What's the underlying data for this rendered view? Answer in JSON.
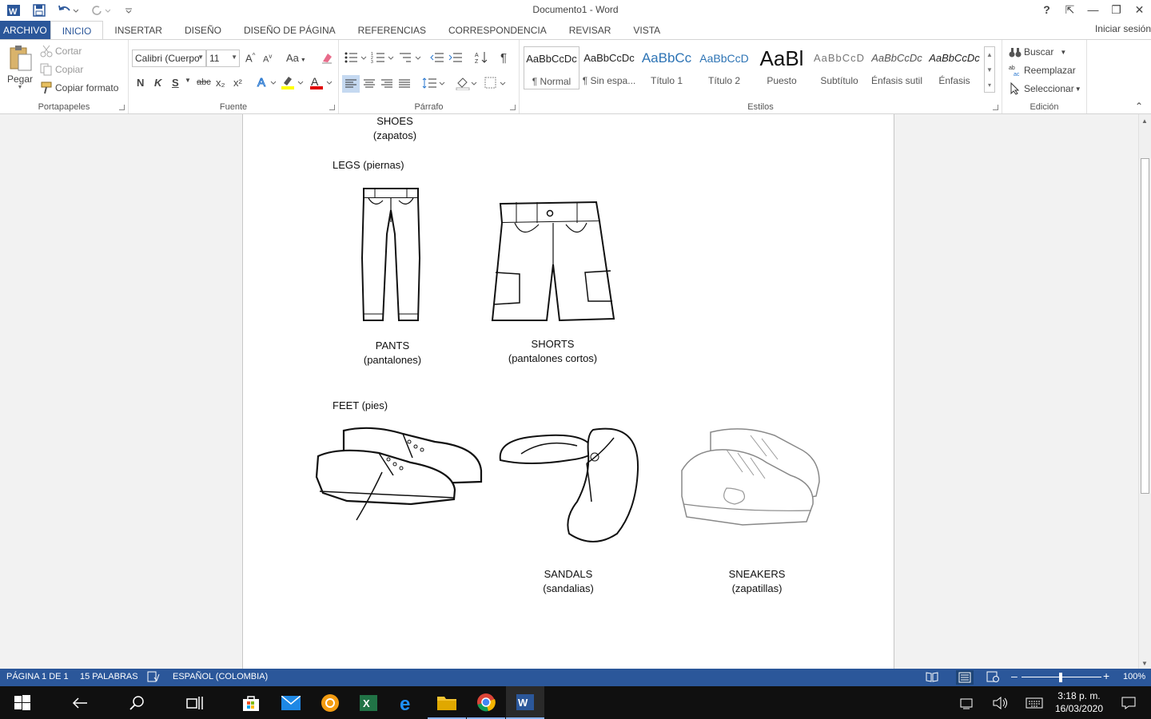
{
  "window": {
    "title": "Documento1 - Word",
    "controls": {
      "help": "?",
      "ribbon_display": "⇱",
      "minimize": "—",
      "restore": "❐",
      "close": "✕"
    }
  },
  "tabs": [
    "ARCHIVO",
    "INICIO",
    "INSERTAR",
    "DISEÑO",
    "DISEÑO DE PÁGINA",
    "REFERENCIAS",
    "CORRESPONDENCIA",
    "REVISAR",
    "VISTA"
  ],
  "signin": "Iniciar sesión",
  "ribbon": {
    "clipboard": {
      "paste": "Pegar",
      "cut": "Cortar",
      "copy": "Copiar",
      "format_painter": "Copiar formato",
      "label": "Portapapeles"
    },
    "font": {
      "family": "Calibri (Cuerpo",
      "size": "11",
      "bold": "N",
      "italic": "K",
      "underline": "S",
      "strike": "abc",
      "sub": "x₂",
      "sup": "x²",
      "grow": "A",
      "shrink": "A",
      "case": "Aa",
      "label": "Fuente"
    },
    "paragraph": {
      "label": "Párrafo",
      "pilcrow": "¶"
    },
    "styles": {
      "label": "Estilos",
      "items": [
        {
          "sample": "AaBbCcDc",
          "name": "¶ Normal"
        },
        {
          "sample": "AaBbCcDc",
          "name": "¶ Sin espa..."
        },
        {
          "sample": "AaBbCc",
          "name": "Título 1"
        },
        {
          "sample": "AaBbCcD",
          "name": "Título 2"
        },
        {
          "sample": "AaBl",
          "name": "Puesto"
        },
        {
          "sample": "AaBbCcD",
          "name": "Subtítulo"
        },
        {
          "sample": "AaBbCcDc",
          "name": "Énfasis sutil"
        },
        {
          "sample": "AaBbCcDc",
          "name": "Énfasis"
        }
      ]
    },
    "editing": {
      "find": "Buscar",
      "replace": "Reemplazar",
      "select": "Seleccionar",
      "label": "Edición"
    }
  },
  "document": {
    "legs_heading": "LEGS (piernas)",
    "pants": {
      "en": "PANTS",
      "es": "(pantalones)"
    },
    "shorts": {
      "en": "SHORTS",
      "es": "(pantalones cortos)"
    },
    "feet_heading": "FEET (pies)",
    "shoes": {
      "en": "SHOES",
      "es": "(zapatos)"
    },
    "sandals": {
      "en": "SANDALS",
      "es": "(sandalias)"
    },
    "sneakers": {
      "en": "SNEAKERS",
      "es": "(zapatillas)"
    }
  },
  "status": {
    "page": "PÁGINA 1 DE 1",
    "words": "15 PALABRAS",
    "language": "ESPAÑOL (COLOMBIA)",
    "zoom": "100%"
  },
  "taskbar": {
    "time": "3:18 p. m.",
    "date": "16/03/2020"
  },
  "colors": {
    "word_blue": "#2b579a",
    "taskbar": "#101010"
  }
}
